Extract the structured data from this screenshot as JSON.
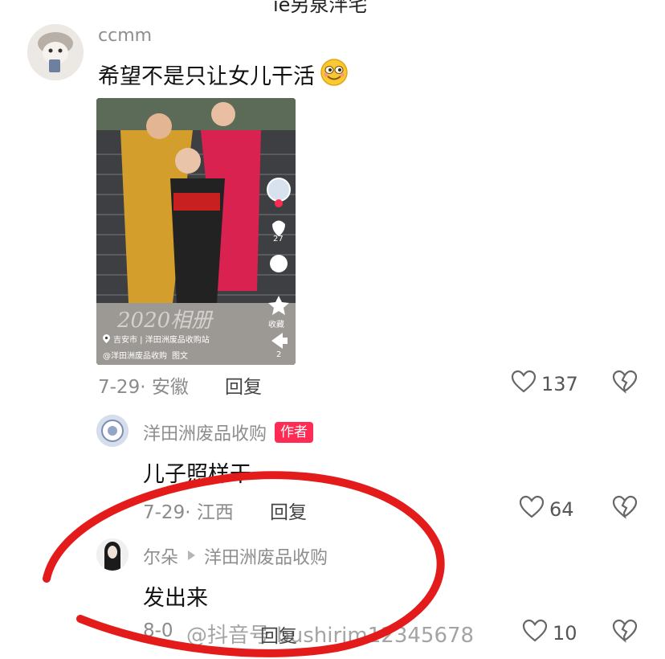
{
  "top_cut_text": "ie另泉泮宅",
  "comments": [
    {
      "username": "ccmm",
      "text": "希望不是只让女儿干活",
      "date_location": "7-29· 安徽",
      "reply_label": "回复",
      "likes": "137",
      "image": {
        "location_tag": "吉安市 | 洋田洲废品收购站",
        "author_tag": "@洋田洲废品收购",
        "type_tag": "图文",
        "stamp": "2020相册",
        "side_likes": "27",
        "side_shares": "2",
        "side_collect": "收藏"
      }
    },
    {
      "username": "洋田洲废品收购",
      "badge": "作者",
      "text": "儿子照样干",
      "date_location": "7-29· 江西",
      "reply_label": "回复",
      "likes": "64"
    },
    {
      "username": "尔朵",
      "reply_to": "洋田洲废品收购",
      "text": "发出来",
      "date_location": "8-0",
      "reply_label": "回复",
      "likes": "10"
    }
  ],
  "watermark": "@抖音号 bushirim12345678",
  "colors": {
    "annotation": "#e41b1b",
    "badge": "#fe2c55"
  }
}
